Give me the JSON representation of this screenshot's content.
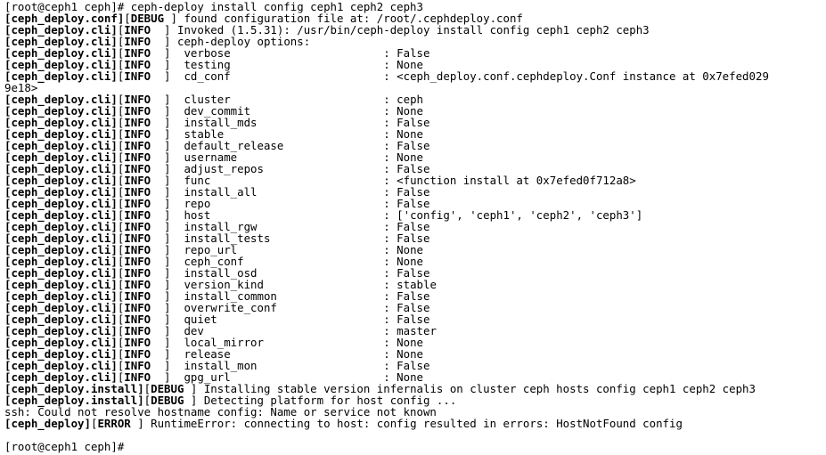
{
  "terminal": {
    "lines": [
      {
        "segments": [
          {
            "t": "[root@ceph1 ceph]# ceph-deploy install config ceph1 ceph2 ceph3",
            "b": false
          }
        ]
      },
      {
        "segments": [
          {
            "t": "[ceph_deploy.conf]",
            "b": true
          },
          {
            "t": "[",
            "b": false
          },
          {
            "t": "DEBUG",
            "b": true
          },
          {
            "t": " ] found configuration file at: /root/.cephdeploy.conf",
            "b": false
          }
        ]
      },
      {
        "segments": [
          {
            "t": "[ceph_deploy.cli]",
            "b": true
          },
          {
            "t": "[",
            "b": false
          },
          {
            "t": "INFO",
            "b": true
          },
          {
            "t": "  ] Invoked (1.5.31): /usr/bin/ceph-deploy install config ceph1 ceph2 ceph3",
            "b": false
          }
        ]
      },
      {
        "segments": [
          {
            "t": "[ceph_deploy.cli]",
            "b": true
          },
          {
            "t": "[",
            "b": false
          },
          {
            "t": "INFO",
            "b": true
          },
          {
            "t": "  ] ceph-deploy options:",
            "b": false
          }
        ]
      },
      {
        "segments": [
          {
            "t": "[ceph_deploy.cli]",
            "b": true
          },
          {
            "t": "[",
            "b": false
          },
          {
            "t": "INFO",
            "b": true
          },
          {
            "t": "  ]  verbose                       : False",
            "b": false
          }
        ]
      },
      {
        "segments": [
          {
            "t": "[ceph_deploy.cli]",
            "b": true
          },
          {
            "t": "[",
            "b": false
          },
          {
            "t": "INFO",
            "b": true
          },
          {
            "t": "  ]  testing                       : None",
            "b": false
          }
        ]
      },
      {
        "segments": [
          {
            "t": "[ceph_deploy.cli]",
            "b": true
          },
          {
            "t": "[",
            "b": false
          },
          {
            "t": "INFO",
            "b": true
          },
          {
            "t": "  ]  cd_conf                       : <ceph_deploy.conf.cephdeploy.Conf instance at 0x7efed029",
            "b": false
          }
        ]
      },
      {
        "segments": [
          {
            "t": "9e18>",
            "b": false
          }
        ]
      },
      {
        "segments": [
          {
            "t": "[ceph_deploy.cli]",
            "b": true
          },
          {
            "t": "[",
            "b": false
          },
          {
            "t": "INFO",
            "b": true
          },
          {
            "t": "  ]  cluster                       : ceph",
            "b": false
          }
        ]
      },
      {
        "segments": [
          {
            "t": "[ceph_deploy.cli]",
            "b": true
          },
          {
            "t": "[",
            "b": false
          },
          {
            "t": "INFO",
            "b": true
          },
          {
            "t": "  ]  dev_commit                    : None",
            "b": false
          }
        ]
      },
      {
        "segments": [
          {
            "t": "[ceph_deploy.cli]",
            "b": true
          },
          {
            "t": "[",
            "b": false
          },
          {
            "t": "INFO",
            "b": true
          },
          {
            "t": "  ]  install_mds                   : False",
            "b": false
          }
        ]
      },
      {
        "segments": [
          {
            "t": "[ceph_deploy.cli]",
            "b": true
          },
          {
            "t": "[",
            "b": false
          },
          {
            "t": "INFO",
            "b": true
          },
          {
            "t": "  ]  stable                        : None",
            "b": false
          }
        ]
      },
      {
        "segments": [
          {
            "t": "[ceph_deploy.cli]",
            "b": true
          },
          {
            "t": "[",
            "b": false
          },
          {
            "t": "INFO",
            "b": true
          },
          {
            "t": "  ]  default_release               : False",
            "b": false
          }
        ]
      },
      {
        "segments": [
          {
            "t": "[ceph_deploy.cli]",
            "b": true
          },
          {
            "t": "[",
            "b": false
          },
          {
            "t": "INFO",
            "b": true
          },
          {
            "t": "  ]  username                      : None",
            "b": false
          }
        ]
      },
      {
        "segments": [
          {
            "t": "[ceph_deploy.cli]",
            "b": true
          },
          {
            "t": "[",
            "b": false
          },
          {
            "t": "INFO",
            "b": true
          },
          {
            "t": "  ]  adjust_repos                  : False",
            "b": false
          }
        ]
      },
      {
        "segments": [
          {
            "t": "[ceph_deploy.cli]",
            "b": true
          },
          {
            "t": "[",
            "b": false
          },
          {
            "t": "INFO",
            "b": true
          },
          {
            "t": "  ]  func                          : <function install at 0x7efed0f712a8>",
            "b": false
          }
        ]
      },
      {
        "segments": [
          {
            "t": "[ceph_deploy.cli]",
            "b": true
          },
          {
            "t": "[",
            "b": false
          },
          {
            "t": "INFO",
            "b": true
          },
          {
            "t": "  ]  install_all                   : False",
            "b": false
          }
        ]
      },
      {
        "segments": [
          {
            "t": "[ceph_deploy.cli]",
            "b": true
          },
          {
            "t": "[",
            "b": false
          },
          {
            "t": "INFO",
            "b": true
          },
          {
            "t": "  ]  repo                          : False",
            "b": false
          }
        ]
      },
      {
        "segments": [
          {
            "t": "[ceph_deploy.cli]",
            "b": true
          },
          {
            "t": "[",
            "b": false
          },
          {
            "t": "INFO",
            "b": true
          },
          {
            "t": "  ]  host                          : ['config', 'ceph1', 'ceph2', 'ceph3']",
            "b": false
          }
        ]
      },
      {
        "segments": [
          {
            "t": "[ceph_deploy.cli]",
            "b": true
          },
          {
            "t": "[",
            "b": false
          },
          {
            "t": "INFO",
            "b": true
          },
          {
            "t": "  ]  install_rgw                   : False",
            "b": false
          }
        ]
      },
      {
        "segments": [
          {
            "t": "[ceph_deploy.cli]",
            "b": true
          },
          {
            "t": "[",
            "b": false
          },
          {
            "t": "INFO",
            "b": true
          },
          {
            "t": "  ]  install_tests                 : False",
            "b": false
          }
        ]
      },
      {
        "segments": [
          {
            "t": "[ceph_deploy.cli]",
            "b": true
          },
          {
            "t": "[",
            "b": false
          },
          {
            "t": "INFO",
            "b": true
          },
          {
            "t": "  ]  repo_url                      : None",
            "b": false
          }
        ]
      },
      {
        "segments": [
          {
            "t": "[ceph_deploy.cli]",
            "b": true
          },
          {
            "t": "[",
            "b": false
          },
          {
            "t": "INFO",
            "b": true
          },
          {
            "t": "  ]  ceph_conf                     : None",
            "b": false
          }
        ]
      },
      {
        "segments": [
          {
            "t": "[ceph_deploy.cli]",
            "b": true
          },
          {
            "t": "[",
            "b": false
          },
          {
            "t": "INFO",
            "b": true
          },
          {
            "t": "  ]  install_osd                   : False",
            "b": false
          }
        ]
      },
      {
        "segments": [
          {
            "t": "[ceph_deploy.cli]",
            "b": true
          },
          {
            "t": "[",
            "b": false
          },
          {
            "t": "INFO",
            "b": true
          },
          {
            "t": "  ]  version_kind                  : stable",
            "b": false
          }
        ]
      },
      {
        "segments": [
          {
            "t": "[ceph_deploy.cli]",
            "b": true
          },
          {
            "t": "[",
            "b": false
          },
          {
            "t": "INFO",
            "b": true
          },
          {
            "t": "  ]  install_common                : False",
            "b": false
          }
        ]
      },
      {
        "segments": [
          {
            "t": "[ceph_deploy.cli]",
            "b": true
          },
          {
            "t": "[",
            "b": false
          },
          {
            "t": "INFO",
            "b": true
          },
          {
            "t": "  ]  overwrite_conf                : False",
            "b": false
          }
        ]
      },
      {
        "segments": [
          {
            "t": "[ceph_deploy.cli]",
            "b": true
          },
          {
            "t": "[",
            "b": false
          },
          {
            "t": "INFO",
            "b": true
          },
          {
            "t": "  ]  quiet                         : False",
            "b": false
          }
        ]
      },
      {
        "segments": [
          {
            "t": "[ceph_deploy.cli]",
            "b": true
          },
          {
            "t": "[",
            "b": false
          },
          {
            "t": "INFO",
            "b": true
          },
          {
            "t": "  ]  dev                           : master",
            "b": false
          }
        ]
      },
      {
        "segments": [
          {
            "t": "[ceph_deploy.cli]",
            "b": true
          },
          {
            "t": "[",
            "b": false
          },
          {
            "t": "INFO",
            "b": true
          },
          {
            "t": "  ]  local_mirror                  : None",
            "b": false
          }
        ]
      },
      {
        "segments": [
          {
            "t": "[ceph_deploy.cli]",
            "b": true
          },
          {
            "t": "[",
            "b": false
          },
          {
            "t": "INFO",
            "b": true
          },
          {
            "t": "  ]  release                       : None",
            "b": false
          }
        ]
      },
      {
        "segments": [
          {
            "t": "[ceph_deploy.cli]",
            "b": true
          },
          {
            "t": "[",
            "b": false
          },
          {
            "t": "INFO",
            "b": true
          },
          {
            "t": "  ]  install_mon                   : False",
            "b": false
          }
        ]
      },
      {
        "segments": [
          {
            "t": "[ceph_deploy.cli]",
            "b": true
          },
          {
            "t": "[",
            "b": false
          },
          {
            "t": "INFO",
            "b": true
          },
          {
            "t": "  ]  gpg_url                       : None",
            "b": false
          }
        ]
      },
      {
        "segments": [
          {
            "t": "[ceph_deploy.install]",
            "b": true
          },
          {
            "t": "[",
            "b": false
          },
          {
            "t": "DEBUG",
            "b": true
          },
          {
            "t": " ] Installing stable version infernalis on cluster ceph hosts config ceph1 ceph2 ceph3",
            "b": false
          }
        ]
      },
      {
        "segments": [
          {
            "t": "[ceph_deploy.install]",
            "b": true
          },
          {
            "t": "[",
            "b": false
          },
          {
            "t": "DEBUG",
            "b": true
          },
          {
            "t": " ] Detecting platform for host config ...",
            "b": false
          }
        ]
      },
      {
        "segments": [
          {
            "t": "ssh: Could not resolve hostname config: Name or service not known",
            "b": false
          }
        ]
      },
      {
        "segments": [
          {
            "t": "[ceph_deploy]",
            "b": true
          },
          {
            "t": "[",
            "b": false
          },
          {
            "t": "ERROR",
            "b": true
          },
          {
            "t": " ] RuntimeError: connecting to host: config resulted in errors: HostNotFound config",
            "b": false
          }
        ]
      },
      {
        "segments": []
      },
      {
        "segments": [
          {
            "t": "[root@ceph1 ceph]# ",
            "b": false
          }
        ]
      }
    ]
  }
}
